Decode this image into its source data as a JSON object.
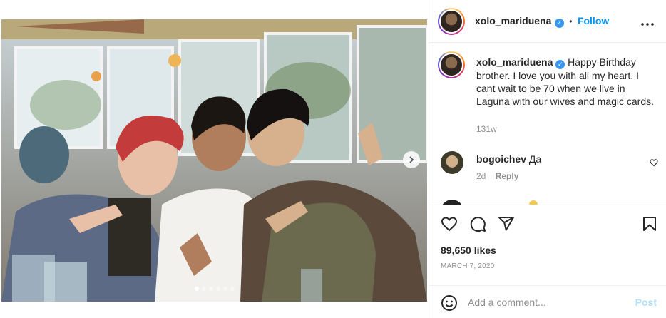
{
  "post": {
    "author": {
      "username": "xolo_mariduena",
      "verified": true,
      "follow_label": "Follow",
      "separator": "•"
    },
    "more_icon": "more-horizontal-icon",
    "caption": {
      "username": "xolo_mariduena",
      "text": "Happy Birthday brother. I love you with all my heart. I cant wait to be 70 when we live in Laguna with our wives and magic cards.",
      "age": "131w"
    },
    "comments": [
      {
        "username": "bogoichev",
        "text": "Да",
        "age": "2d",
        "reply_label": "Reply"
      }
    ],
    "likes": "89,650 likes",
    "date": "MARCH 7, 2020",
    "add_comment": {
      "placeholder": "Add a comment...",
      "post_label": "Post"
    },
    "carousel": {
      "slide_count": 6,
      "active_index": 0
    },
    "colors": {
      "accent": "#0095f6",
      "verified": "#3897f0",
      "muted": "#8e8e8e",
      "post_disabled": "#b2dffc"
    }
  }
}
